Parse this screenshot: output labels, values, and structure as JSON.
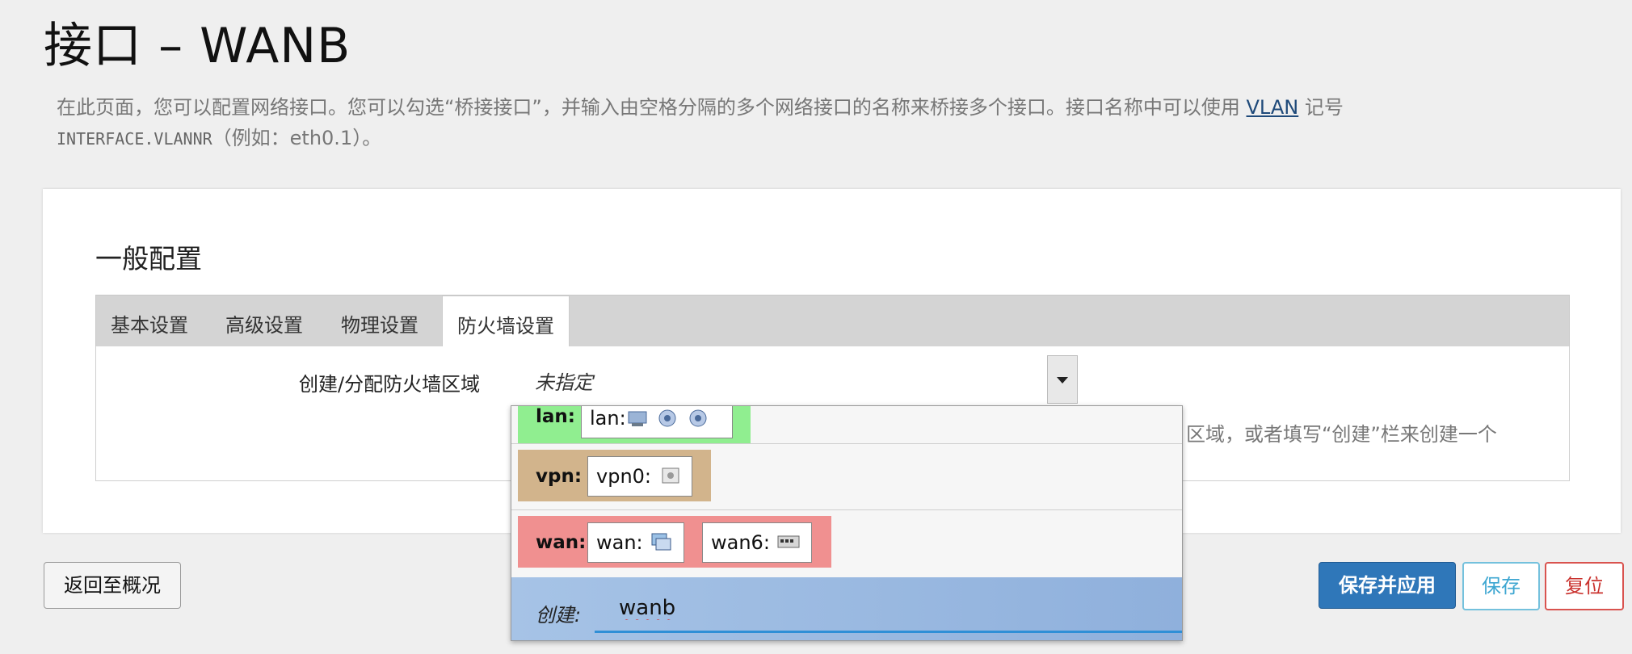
{
  "page": {
    "title": "接口 – WANB",
    "description_text": "在此页面，您可以配置网络接口。您可以勾选“桥接接口”，并输入由空格分隔的多个网络接口的名称来桥接多个接口。接口名称中可以使用",
    "description_link": "VLAN",
    "description_after_link": "记号",
    "description_mono": "INTERFACE.VLANNR",
    "description_example": "（例如：eth0.1）。"
  },
  "section": {
    "title": "一般配置",
    "tabs": [
      {
        "label": "基本设置",
        "active": false
      },
      {
        "label": "高级设置",
        "active": false
      },
      {
        "label": "物理设置",
        "active": false
      },
      {
        "label": "防火墙设置",
        "active": true
      }
    ]
  },
  "firewall": {
    "label": "创建/分配防火墙区域",
    "selected": "未指定",
    "hint": "区域，或者填写“创建”栏来创建一个"
  },
  "dropdown": {
    "options": [
      {
        "zone": "lan:",
        "color": "#90ee90",
        "networks": [
          "lan:"
        ]
      },
      {
        "zone": "vpn:",
        "color": "#d2b48c",
        "networks": [
          "vpn0:"
        ]
      },
      {
        "zone": "wan:",
        "color": "#f09090",
        "networks": [
          "wan:",
          "wan6:"
        ]
      }
    ],
    "create_label": "创建:",
    "create_value": "wanb"
  },
  "buttons": {
    "back": "返回至概况",
    "save_apply": "保存并应用",
    "save": "保存",
    "reset": "复位"
  },
  "icons": [
    "network-port-icon",
    "wifi-icon",
    "tunnel-icon",
    "ethernet-icon",
    "switch-icon"
  ]
}
